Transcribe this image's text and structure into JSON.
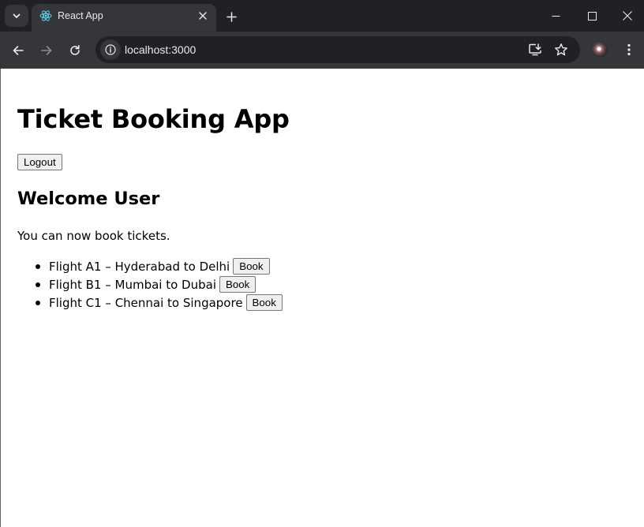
{
  "browser": {
    "tab_title": "React App",
    "url": "localhost:3000"
  },
  "icons": {
    "tab_list": "chevron-down-icon",
    "favicon": "react-logo-icon",
    "tab_close": "close-icon",
    "new_tab": "plus-icon",
    "minimize": "minimize-icon",
    "maximize": "maximize-icon",
    "close_window": "close-icon",
    "back": "arrow-left-icon",
    "forward": "arrow-right-icon",
    "reload": "reload-icon",
    "site_info": "info-icon",
    "install": "install-app-icon",
    "bookmark": "star-icon",
    "menu": "kebab-menu-icon"
  },
  "colors": {
    "chrome_dark": "#202124",
    "chrome_toolbar": "#35363a",
    "react_blue": "#61dafb"
  },
  "page": {
    "title": "Ticket Booking App",
    "logout_label": "Logout",
    "welcome": "Welcome User",
    "intro": "You can now book tickets.",
    "flights": [
      {
        "label": "Flight A1 – Hyderabad to Delhi",
        "button": "Book"
      },
      {
        "label": "Flight B1 – Mumbai to Dubai",
        "button": "Book"
      },
      {
        "label": "Flight C1 – Chennai to Singapore",
        "button": "Book"
      }
    ]
  }
}
